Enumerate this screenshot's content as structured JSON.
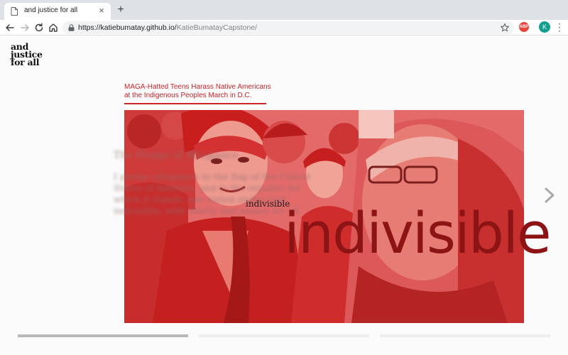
{
  "browser": {
    "tab_title": "and justice for all",
    "tab_close_glyph": "×",
    "new_tab_glyph": "+",
    "url_base": "https://katiebumatay.github.io/",
    "url_path": "KatieBumatayCapstone/",
    "abp_label": "ABP",
    "profile_initial": "K",
    "menu_glyph": "⋮"
  },
  "site": {
    "logo_lines": [
      "and",
      "justice",
      "for all"
    ]
  },
  "slide": {
    "headline": "MAGA-Hatted Teens Harass Native Americans at the Indigenous Peoples March in D.C.",
    "blurred_title": "The Pledge of Allegiance",
    "blurred_body": "I pledge allegiance to the flag of the United States of America, and to the republic for which it stands, one nation under God, indivisible, with liberty and justice for all.",
    "small_word": "indivisible",
    "big_word": "indivisible"
  },
  "slider": {
    "segments": [
      {
        "label": "slide-1",
        "progress": 1.0
      },
      {
        "label": "slide-2",
        "progress": 0.0
      },
      {
        "label": "slide-3",
        "progress": 0.0
      }
    ]
  },
  "colors": {
    "accent_red": "#c8242b",
    "big_word": "#8d1414",
    "photo_tint": "#e25e5e"
  },
  "icons": [
    "page-icon",
    "close-icon",
    "plus-icon",
    "back-arrow-icon",
    "forward-arrow-icon",
    "reload-icon",
    "home-icon",
    "lock-icon",
    "star-icon",
    "adblock-icon",
    "profile-avatar",
    "more-menu-icon",
    "chevron-right-icon"
  ]
}
